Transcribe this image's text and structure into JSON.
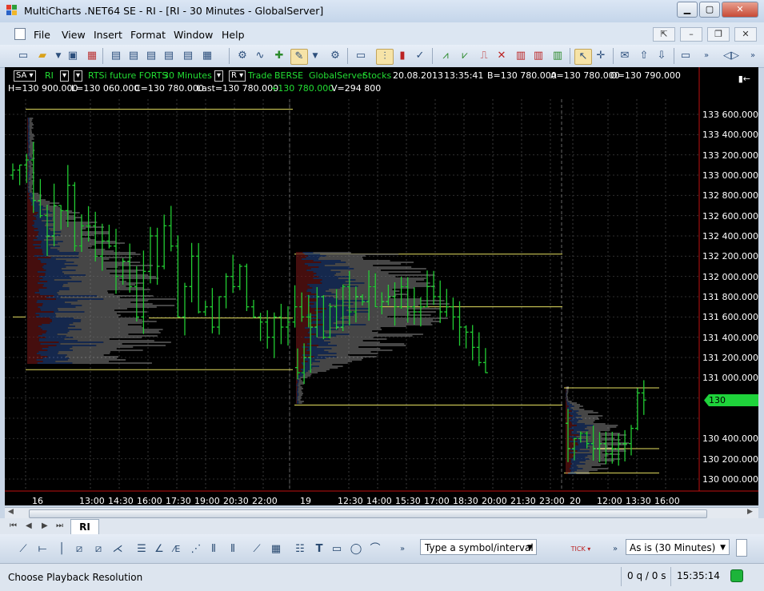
{
  "window": {
    "title": "MultiCharts .NET64 SE - RI - [RI - 30 Minutes - GlobalServer]"
  },
  "menu": [
    "File",
    "View",
    "Insert",
    "Format",
    "Window",
    "Help"
  ],
  "chart_header": {
    "style_box": "SA",
    "symbol": "RI",
    "description": "RTSi future FORTS",
    "interval": "30 Minutes",
    "range_box": "R",
    "data_type": "Trade",
    "exchange": "BERSE",
    "server": "GlobalServer",
    "category": "Stocks",
    "date": "20.08.2013",
    "time": "13:35:41",
    "bid": "B=130 780.000",
    "ask": "A=130 780.000",
    "open": "O=130 790.000",
    "high": "H=130 900.000",
    "low": "L=130 060.000",
    "close": "C=130 780.000",
    "last": "Last=130 780.000",
    "change": "+130 780.000",
    "volume": "V=294 800",
    "end_marker": "▮←"
  },
  "price_axis": {
    "labels": [
      "133 600.000",
      "133 400.000",
      "133 200.000",
      "133 000.000",
      "132 800.000",
      "132 600.000",
      "132 400.000",
      "132 200.000",
      "132 000.000",
      "131 800.000",
      "131 600.000",
      "131 400.000",
      "131 200.000",
      "131 000.000",
      "130 400.000",
      "130 200.000",
      "130 000.000"
    ],
    "last_price": "130 780.000"
  },
  "time_axis": {
    "labels": [
      "16",
      "13:00",
      "14:30",
      "16:00",
      "17:30",
      "19:00",
      "20:30",
      "22:00",
      "19",
      "12:30",
      "14:00",
      "15:30",
      "17:00",
      "18:30",
      "20:00",
      "21:30",
      "23:00",
      "20",
      "12:00",
      "13:30",
      "16:00"
    ]
  },
  "tabs": {
    "active": "RI"
  },
  "drawbar": {
    "symbol_placeholder": "Type a symbol/interval",
    "resolution": "As is (30 Minutes)",
    "tick_label": "TICK"
  },
  "status": {
    "text": "Choose Playback Resolution",
    "queue": "0 q / 0 s",
    "clock": "15:35:14"
  },
  "colors": {
    "chart_bg": "#000000",
    "bar": "#22cc33",
    "level_line": "#e6e060",
    "profile_buy": "#2a4f9a",
    "profile_sell": "#8a1d1d",
    "profile_neutral": "#8c8c8c",
    "axis_red": "#c01010"
  },
  "chart_data": {
    "type": "ohlc",
    "sessions": [
      {
        "date": "16",
        "value_high": 133650,
        "value_low": 131080,
        "mid": 131600
      },
      {
        "date": "19",
        "value_high": 132220,
        "value_low": 130730,
        "mid": 131750
      },
      {
        "date": "20",
        "value_high": 130900,
        "value_low": 130060,
        "mid": 130350
      }
    ],
    "last": 130780,
    "ylim": [
      129920,
      133680
    ]
  }
}
